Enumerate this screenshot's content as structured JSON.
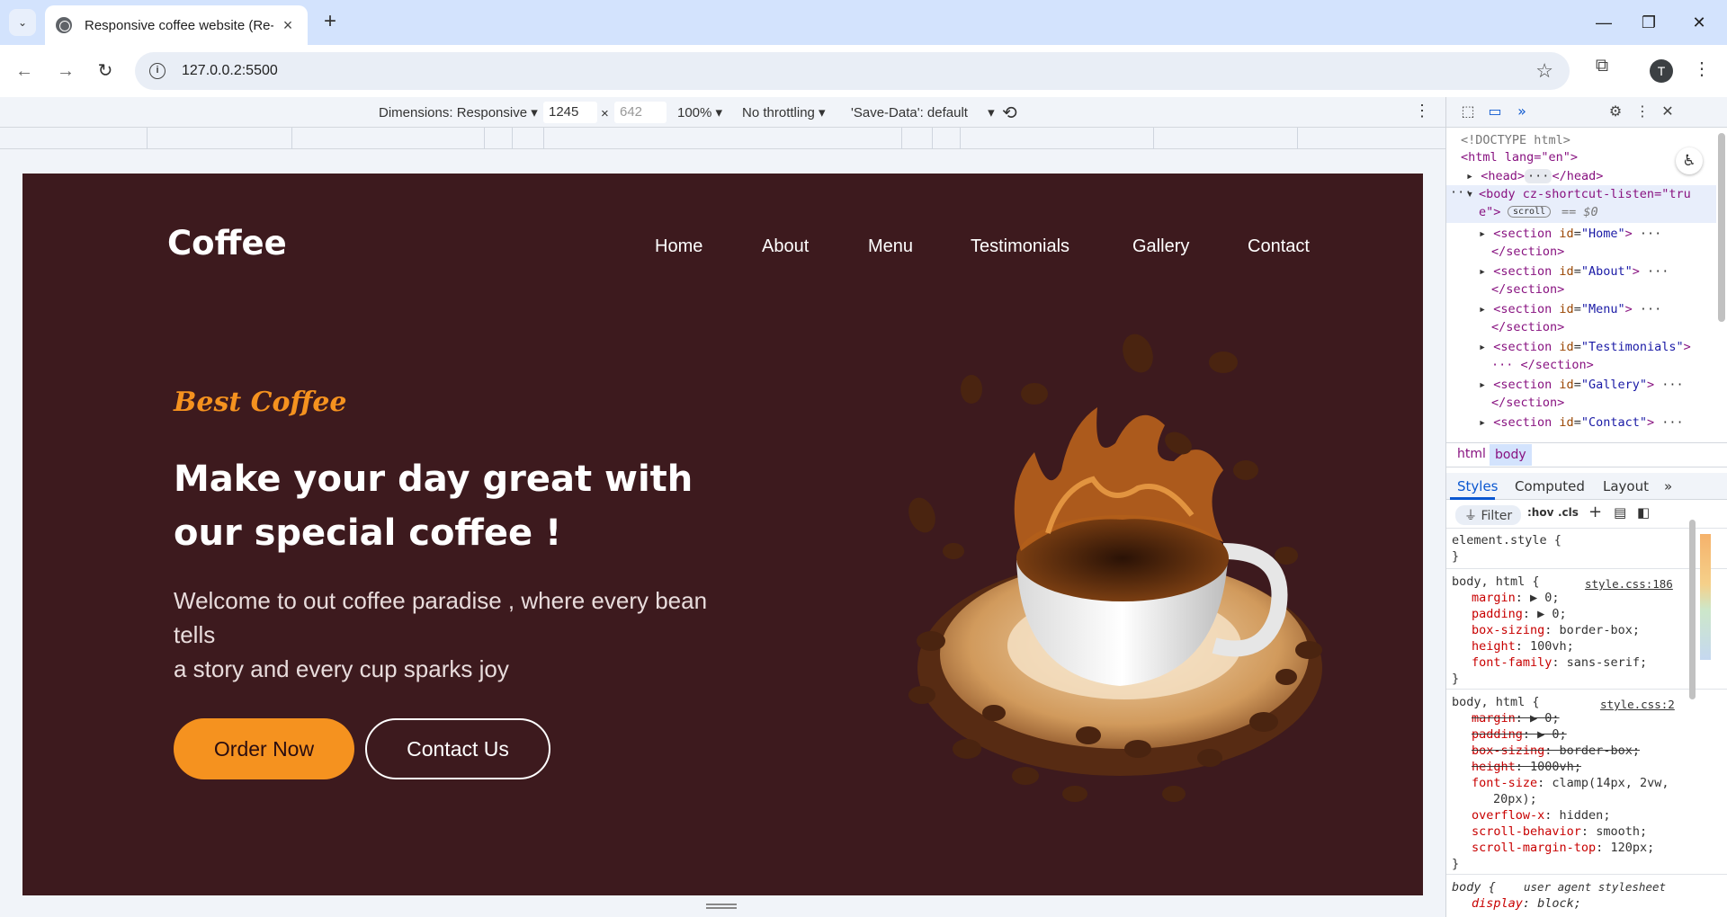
{
  "browser": {
    "tab_title": "Responsive coffee website (Re-c",
    "url": "127.0.0.2:5500",
    "profile_initial": "T"
  },
  "device_toolbar": {
    "dimensions_label": "Dimensions: Responsive",
    "width": "1245",
    "height_placeholder": "642",
    "times": "×",
    "zoom": "100%",
    "throttling": "No throttling",
    "save_data": "'Save-Data': default"
  },
  "site": {
    "logo": "Coffee",
    "nav": [
      "Home",
      "About",
      "Menu",
      "Testimonials",
      "Gallery",
      "Contact"
    ],
    "tagline": "Best Coffee",
    "headline_line1": "Make your day great with",
    "headline_line2": "our special coffee !",
    "subtext_line1": "Welcome to out coffee paradise , where every bean",
    "subtext_line2": "tells",
    "subtext_line3": "a story and every cup sparks joy",
    "order_button": "Order Now",
    "contact_button": "Contact Us",
    "colors": {
      "background": "#3d1a1e",
      "accent": "#f5921f"
    }
  },
  "devtools": {
    "dom": {
      "doctype": "<!DOCTYPE html>",
      "html_open": "<html lang=\"en\">",
      "head": "<head>",
      "head_close": "</head>",
      "body_open": "<body cz-shortcut-listen=\"tru",
      "body_open_2": "e\">",
      "scroll_badge": "scroll",
      "eq0": "== $0",
      "sections": [
        "Home",
        "About",
        "Menu",
        "Testimonials",
        "Gallery",
        "Contact"
      ],
      "section_close": "</section>"
    },
    "breadcrumbs": [
      "html",
      "body"
    ],
    "style_tabs": [
      "Styles",
      "Computed",
      "Layout"
    ],
    "filter_placeholder": "Filter",
    "hov": ":hov",
    "cls": ".cls",
    "rules": {
      "element_style": "element.style {",
      "close": "}",
      "r1_selector": "body, html {",
      "r1_source": "style.css:186",
      "r1_props": [
        [
          "margin",
          "▶ 0;"
        ],
        [
          "padding",
          "▶ 0;"
        ],
        [
          "box-sizing",
          "border-box;"
        ],
        [
          "height",
          "100vh;"
        ],
        [
          "font-family",
          "sans-serif;"
        ]
      ],
      "r2_selector": "body, html {",
      "r2_source": "style.css:2",
      "r2_struck": [
        [
          "margin",
          "▶ 0;"
        ],
        [
          "padding",
          "▶ 0;"
        ],
        [
          "box-sizing",
          "border-box;"
        ],
        [
          "height",
          "1000vh;"
        ]
      ],
      "r2_fontsize": "font-size",
      "r2_fontsize_val": "clamp(14px, 2vw,",
      "r2_fontsize_val2": "20px);",
      "r2_props": [
        [
          "overflow-x",
          "hidden;"
        ],
        [
          "scroll-behavior",
          "smooth;"
        ],
        [
          "scroll-margin-top",
          "120px;"
        ]
      ],
      "r3_selector": "body {",
      "r3_source": "user agent stylesheet",
      "r3_prop": "display",
      "r3_val": "block;"
    }
  }
}
